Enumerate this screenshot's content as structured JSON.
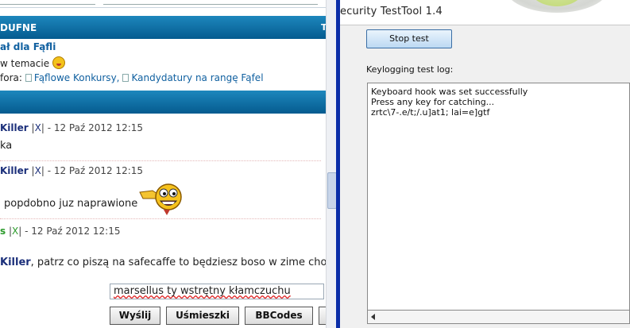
{
  "forum": {
    "pinned_header": "DUFNE",
    "pinned_header_right": "T",
    "pinned_title": "ał dla Fąfli",
    "pinned_text": "w temacie",
    "pinned_forums_label": "fora:",
    "pinned_links": [
      "Fąflowe Konkursy,",
      "Kandydatury na rangę Fąfel"
    ],
    "posts": [
      {
        "user": "Killer",
        "sep": "|",
        "x": "X",
        "after": "|",
        "date": "- 12 Paź 2012 12:15",
        "text": "ka"
      },
      {
        "user": "Killer",
        "sep": "|",
        "x": "X",
        "after": "|",
        "date": "- 12 Paź 2012 12:15",
        "text": "popdobno juz naprawione"
      },
      {
        "user": "s",
        "sep": "|",
        "x": "X",
        "after": "|",
        "date": "- 12 Paź 2012 12:15"
      }
    ],
    "last_text_user": "Killer",
    "last_text_rest": ", patrz co piszą na safecaffe to będziesz boso w zime chodz",
    "input_value": "marsellus ty wstrętny kłamczuchu",
    "buttons": {
      "send": "Wyślij",
      "smileys": "Uśmieszki",
      "bbcodes": "BBCodes"
    }
  },
  "tool": {
    "title": "ecurity TestTool  1.4",
    "stop_button": "Stop test",
    "log_label": "Keylogging test log:",
    "log_lines": [
      "Keyboard hook was set successfully",
      "Press any key for catching...",
      "zrtc\\7-.e/t;/.u]at1; lai=e]gtf"
    ]
  },
  "colors": {
    "forum_bar": "#0b6aa3",
    "username": "#1b2f7a",
    "username_green": "#2a9a2a",
    "divider": "#0a2da8",
    "button_blue": "#bcd9f3"
  }
}
